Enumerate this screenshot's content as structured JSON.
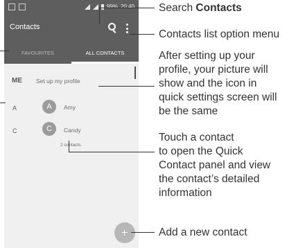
{
  "status_bar": {
    "time": "20:40",
    "battery": "99%"
  },
  "toolbar": {
    "title": "Contacts"
  },
  "tabs": [
    {
      "label": "FAVOURITES"
    },
    {
      "label": "ALL CONTACTS"
    }
  ],
  "me_row": {
    "label": "ME",
    "text": "Set up my profile"
  },
  "contacts": [
    {
      "section": "A",
      "initial": "A",
      "name": "Amy"
    },
    {
      "section": "C",
      "initial": "C",
      "name": "Candy"
    }
  ],
  "contact_count": "2 contacts",
  "callouts": {
    "search_prefix": "Search ",
    "search_bold": "Contacts",
    "options_menu": "Contacts list option menu",
    "profile": [
      "After setting up your",
      "profile, your picture will",
      "show and the icon in",
      "quick settings screen will",
      "be the same"
    ],
    "touch_contact": [
      "Touch a contact",
      "to open the Quick",
      "Contact panel and view",
      "the contact’s detailed",
      "information"
    ],
    "add_contact": "Add a new contact"
  }
}
